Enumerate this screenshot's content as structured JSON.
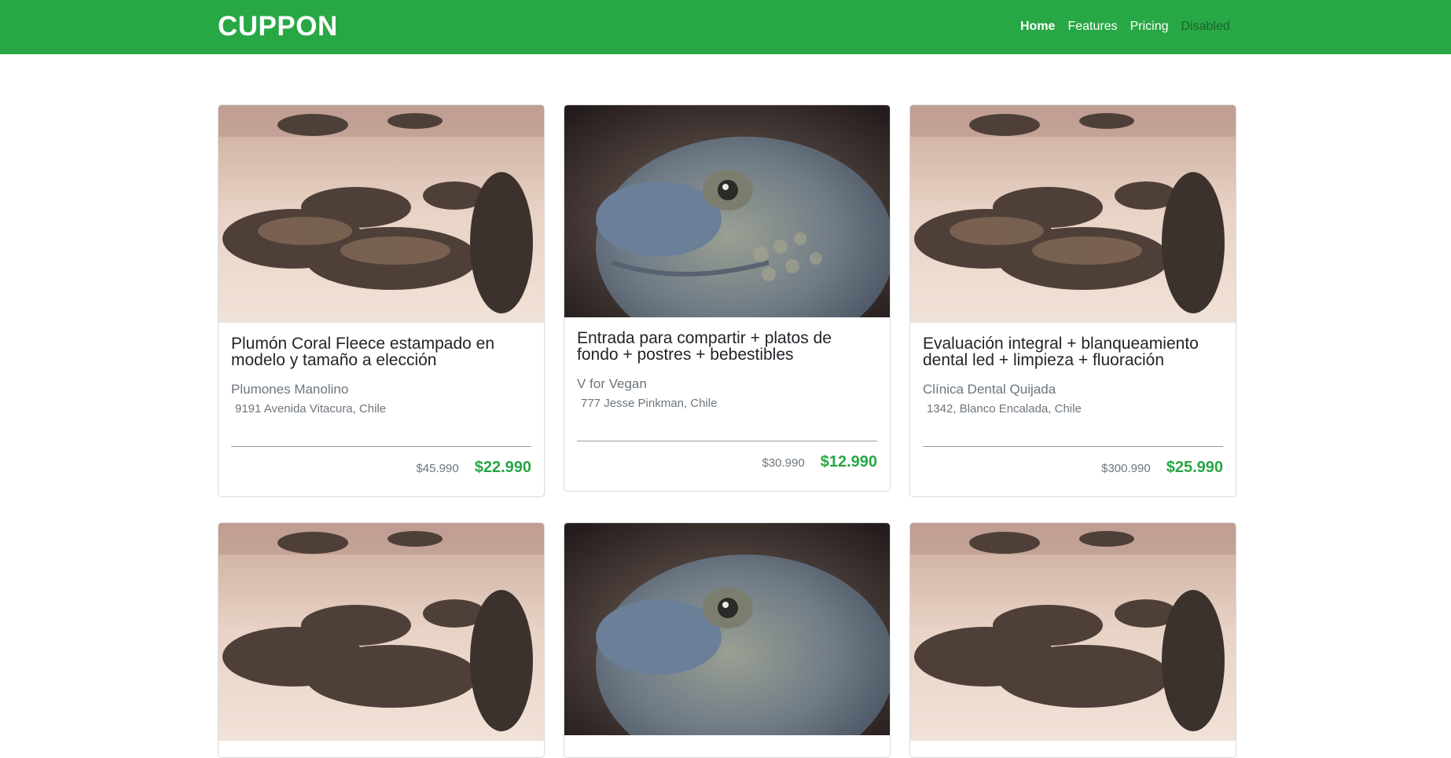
{
  "navbar": {
    "brand": "CUPPON",
    "links": [
      {
        "label": "Home"
      },
      {
        "label": "Features"
      },
      {
        "label": "Pricing"
      },
      {
        "label": "Disabled"
      }
    ]
  },
  "colors": {
    "brand_green": "#28a745",
    "muted": "#6c757d"
  },
  "cards": [
    {
      "image": "iguanas-on-beach-photo",
      "title": "Plumón Coral Fleece estampado en modelo y tamaño a elección",
      "company": "Plumones Manolino",
      "address": "9191 Avenida Vitacura, Chile",
      "old_price": "$45.990",
      "new_price": "$22.990"
    },
    {
      "image": "iguana-head-closeup-photo",
      "title": "Entrada para compartir + platos de fondo + postres + bebestibles",
      "company": "V for Vegan",
      "address": "777 Jesse Pinkman, Chile",
      "old_price": "$30.990",
      "new_price": "$12.990"
    },
    {
      "image": "iguanas-on-beach-photo",
      "title": "Evaluación integral + blanqueamiento dental led + limpieza + fluoración",
      "company": "Clínica Dental Quijada",
      "address": "1342, Blanco Encalada, Chile",
      "old_price": "$300.990",
      "new_price": "$25.990"
    },
    {
      "image": "iguanas-on-beach-photo"
    },
    {
      "image": "iguana-head-closeup-photo"
    },
    {
      "image": "iguanas-on-beach-photo"
    }
  ]
}
